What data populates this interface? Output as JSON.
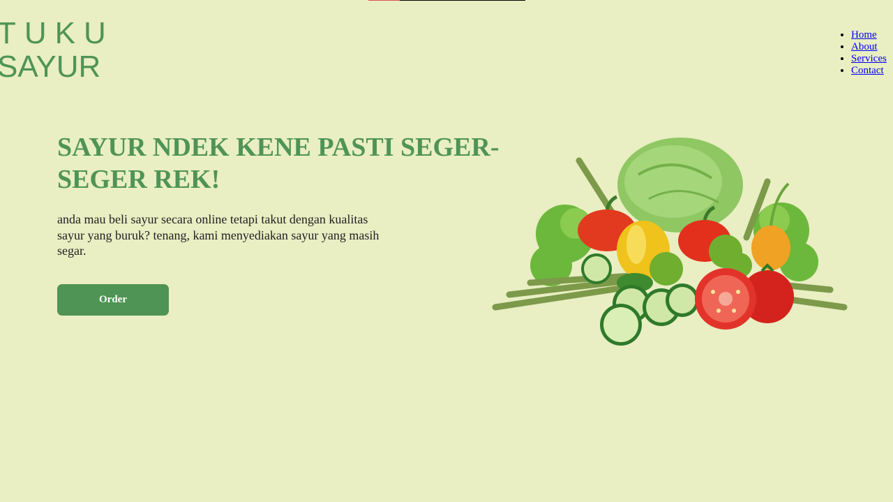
{
  "logo": {
    "line1": "TUKU",
    "line2": "SAYUR"
  },
  "nav": {
    "items": [
      {
        "label": "Home"
      },
      {
        "label": "About"
      },
      {
        "label": "Services"
      },
      {
        "label": "Contact"
      }
    ]
  },
  "hero": {
    "title": "SAYUR NDEK KENE PASTI SEGER-SEGER REK!",
    "description": "anda mau beli sayur secara online tetapi takut dengan kualitas sayur yang buruk? tenang, kami menyediakan sayur yang masih segar.",
    "order_label": "Order"
  },
  "image": {
    "icon": "vegetables-illustration"
  },
  "colors": {
    "background": "#e9eec3",
    "brand": "#4f9454",
    "link": "#0000ee"
  }
}
